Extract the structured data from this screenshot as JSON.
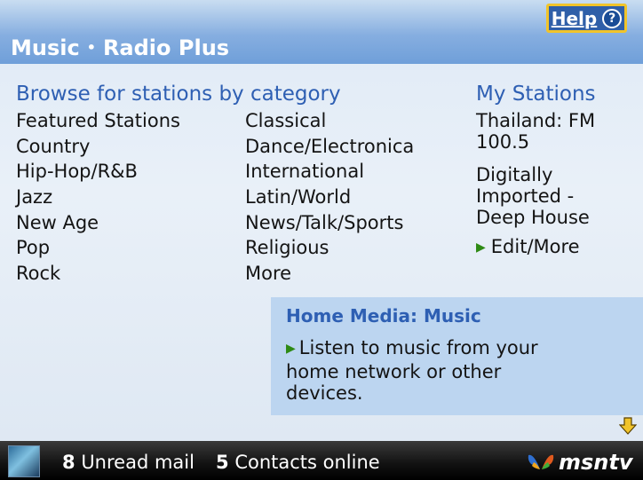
{
  "header": {
    "app_name": "Music",
    "separator": "•",
    "section": "Radio Plus",
    "help_label": "Help",
    "help_icon_glyph": "?"
  },
  "browse": {
    "heading": "Browse for stations by category",
    "column1": [
      "Featured Stations",
      "Country",
      "Hip-Hop/R&B",
      "Jazz",
      "New Age",
      "Pop",
      "Rock"
    ],
    "column2": [
      "Classical",
      "Dance/Electronica",
      "International",
      "Latin/World",
      "News/Talk/Sports",
      "Religious",
      "More"
    ]
  },
  "my_stations": {
    "heading": "My Stations",
    "stations": [
      "Thailand: FM 100.5",
      "Digitally Imported - Deep House"
    ],
    "edit_label": "Edit/More"
  },
  "home_media": {
    "title": "Home Media: Music",
    "link": "Listen to music from your home network or other devices."
  },
  "footer": {
    "unread_count": "8",
    "unread_label": "Unread mail",
    "contacts_count": "5",
    "contacts_label": "Contacts online",
    "logo_text": "msntv"
  },
  "icons": {
    "help": "help-question-icon",
    "link_arrow": "green-triangle-arrow-icon",
    "scroll": "yellow-down-arrow-icon",
    "logo": "msn-butterfly-icon"
  },
  "colors": {
    "heading_blue": "#2e5fb3",
    "help_border": "#f1c42a",
    "arrow_green": "#2e8a14",
    "home_box": "#b9d4ef"
  }
}
